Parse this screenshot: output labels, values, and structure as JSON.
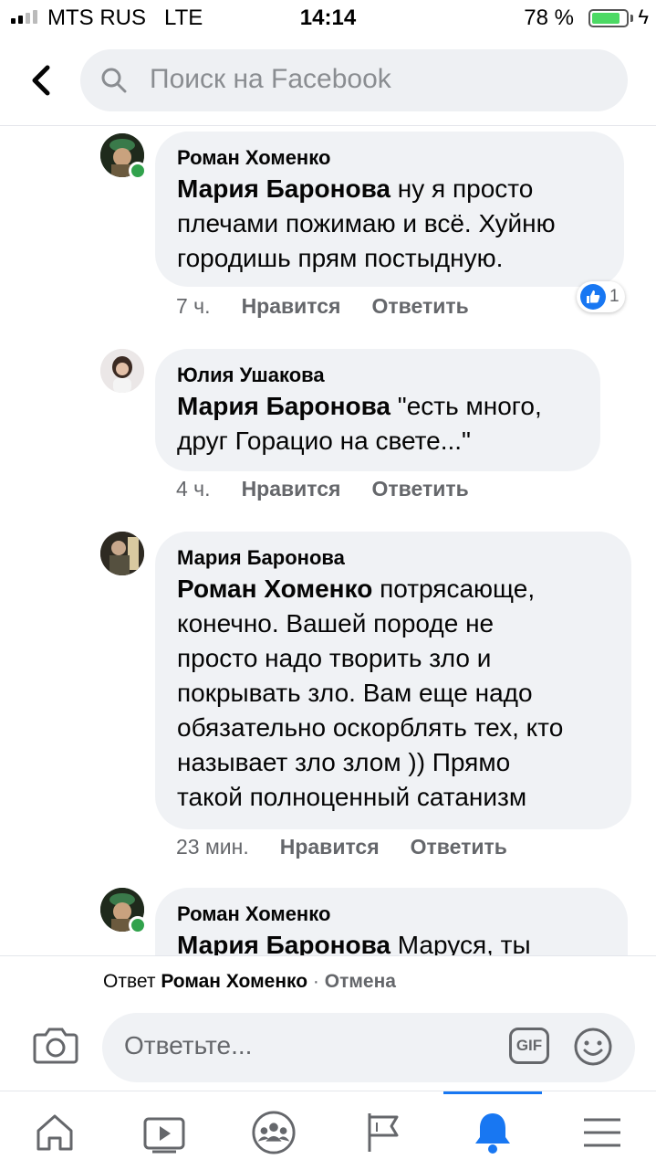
{
  "status_bar": {
    "carrier": "MTS RUS",
    "network": "LTE",
    "time": "14:14",
    "battery": "78 %",
    "battery_level": 0.78
  },
  "header": {
    "search_placeholder": "Поиск на Facebook"
  },
  "comments": [
    {
      "author": "Роман Хоменко",
      "mention": "Мария Баронова",
      "lines": [
        " ну я просто",
        "плечами пожимаю и всё. Хуйню",
        "городишь прям постыдную."
      ],
      "time": "7 ч.",
      "like": "Нравится",
      "reply": "Ответить",
      "reactions": "1",
      "online": true
    },
    {
      "author": "Юлия Ушакова",
      "mention": "Мария Баронова",
      "lines": [
        " \"есть много,",
        "друг Горацио на свете...\""
      ],
      "time": "4 ч.",
      "like": "Нравится",
      "reply": "Ответить",
      "online": false
    },
    {
      "author": "Мария Баронова",
      "mention": "Роман Хоменко",
      "lines": [
        " потрясающе,",
        "конечно. Вашей породе не",
        "просто надо творить зло и",
        "покрывать зло. Вам еще надо",
        "обязательно оскорблять тех, кто",
        "называет зло злом )) Прямо",
        "такой полноценный сатанизм"
      ],
      "time": "23 мин.",
      "like": "Нравится",
      "reply": "Ответить",
      "online": false
    },
    {
      "author": "Роман Хоменко",
      "mention": "Мария Баронова",
      "lines": [
        " Маруся, ты"
      ],
      "online": true
    }
  ],
  "reply_bar": {
    "prefix": "Ответ",
    "target": "Роман Хоменко",
    "separator": "·",
    "cancel": "Отмена",
    "input_placeholder": "Ответьте...",
    "gif_label": "GIF"
  },
  "tabs": [
    {
      "icon": "home-icon"
    },
    {
      "icon": "video-icon"
    },
    {
      "icon": "groups-icon"
    },
    {
      "icon": "pages-flag-icon"
    },
    {
      "icon": "notifications-bell-icon",
      "active": true
    },
    {
      "icon": "menu-icon"
    }
  ],
  "colors": {
    "accent": "#1877f2",
    "bubble": "#f0f2f5",
    "secondary_text": "#65676b",
    "online": "#31a24c"
  }
}
